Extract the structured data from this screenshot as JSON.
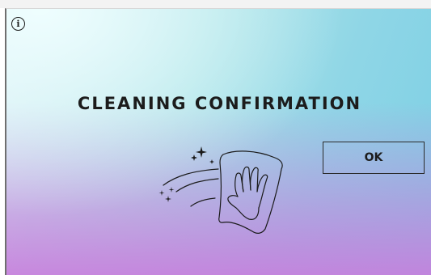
{
  "dialog": {
    "title": "CLEANING CONFIRMATION",
    "ok_label": "OK"
  },
  "icons": {
    "info": "info-icon",
    "illustration": "cleaning-cloth-icon"
  },
  "info_glyph": "i",
  "colors": {
    "gradient_top_left": "#e6f7f8",
    "gradient_right": "#7ccfe4",
    "gradient_bottom": "#c87ddc",
    "text": "#1c1c1c"
  }
}
